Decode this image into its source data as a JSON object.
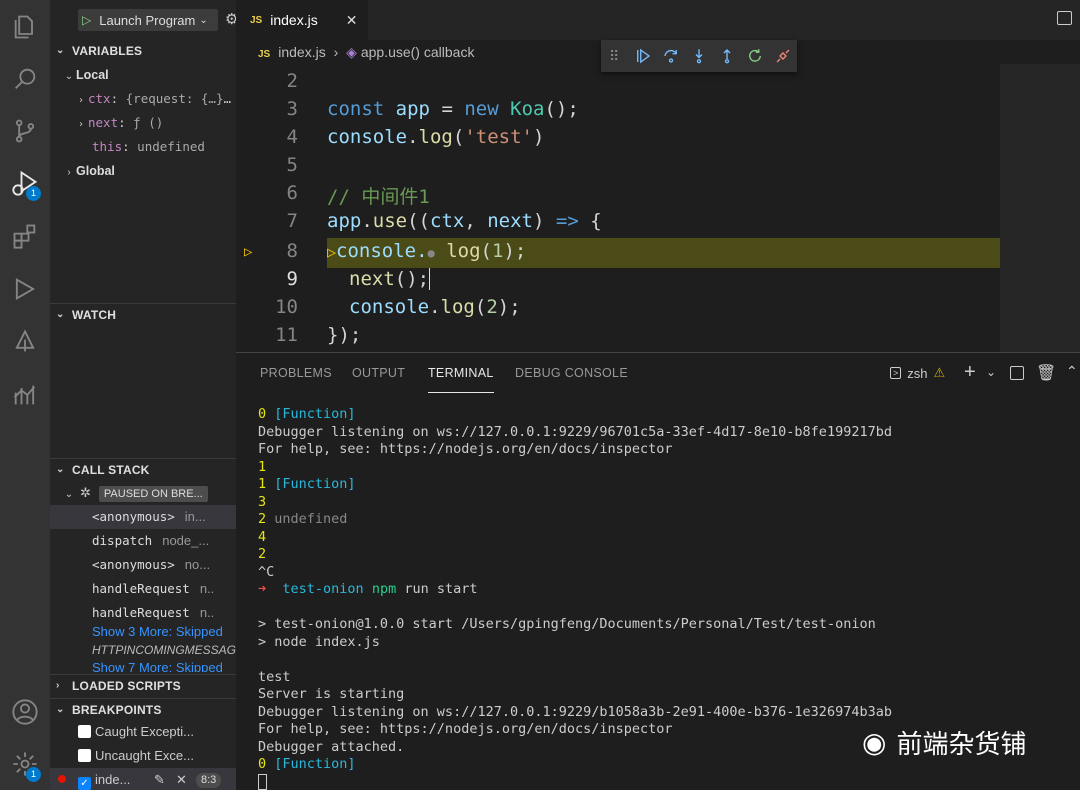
{
  "debug_toolbar": {
    "config": "Launch Program"
  },
  "sidebar": {
    "variables_title": "VARIABLES",
    "local_title": "Local",
    "variables": [
      {
        "name": "ctx",
        "value": "{request: {…}, …"
      },
      {
        "name": "next",
        "value": "ƒ ()"
      },
      {
        "name": "this",
        "value": "undefined"
      }
    ],
    "global_title": "Global",
    "watch_title": "WATCH",
    "callstack_title": "CALL STACK",
    "paused_badge": "PAUSED ON BRE...",
    "frames": [
      {
        "fn": "<anonymous>",
        "src": "in..."
      },
      {
        "fn": "dispatch",
        "src": "node_..."
      },
      {
        "fn": "<anonymous>",
        "src": "no..."
      },
      {
        "fn": "handleRequest",
        "src": "n.."
      },
      {
        "fn": "handleRequest",
        "src": "n.."
      }
    ],
    "show_more_1": "Show 3 More: Skipped",
    "httpincoming": "HTTPINCOMINGMESSAGE",
    "show_more_2": "Show 7 More: Skipped",
    "loaded_scripts_title": "LOADED SCRIPTS",
    "breakpoints_title": "BREAKPOINTS",
    "breakpoints": [
      {
        "label": "Caught Excepti..."
      },
      {
        "label": "Uncaught Exce..."
      },
      {
        "label": "inde...",
        "position": "8:3"
      }
    ]
  },
  "editor": {
    "tab": "index.js",
    "breadcrumb_file": "index.js",
    "breadcrumb_symbol": "app.use() callback",
    "line_numbers": [
      "2",
      "3",
      "4",
      "5",
      "6",
      "7",
      "8",
      "9",
      "10",
      "11"
    ],
    "lines": {
      "l3": {
        "a": "const",
        "b": "app",
        "c": "=",
        "d": "new",
        "e": "Koa",
        "f": "();"
      },
      "l4": {
        "a": "console",
        "b": ".",
        "c": "log",
        "d": "(",
        "e": "'test'",
        "f": ")"
      },
      "l6": "// 中间件1",
      "l7": {
        "a": "app",
        "b": ".",
        "c": "use",
        "d": "((",
        "e": "ctx",
        "f": ", ",
        "g": "next",
        "h": ") ",
        "i": "=>",
        "j": " {"
      },
      "l8": {
        "a": "console.",
        "b": " log",
        "c": "(",
        "d": "1",
        "e": ");"
      },
      "l9": {
        "a": "next",
        "b": "();"
      },
      "l10": {
        "a": "console",
        "b": ".",
        "c": "log",
        "d": "(",
        "e": "2",
        "f": ");"
      },
      "l11": "});"
    }
  },
  "panel": {
    "tabs": [
      "PROBLEMS",
      "OUTPUT",
      "TERMINAL",
      "DEBUG CONSOLE"
    ],
    "shell": "zsh"
  },
  "terminal": [
    {
      "a": "0 ",
      "b": "[Function]"
    },
    {
      "a": "Debugger listening on ws://127.0.0.1:9229/96701c5a-33ef-4d17-8e10-b8fe199217bd"
    },
    {
      "a": "For help, see: https://nodejs.org/en/docs/inspector"
    },
    {
      "a": "1"
    },
    {
      "a": "1 ",
      "b": "[Function]"
    },
    {
      "a": "3"
    },
    {
      "a": "2 ",
      "b": "undefined"
    },
    {
      "a": "4"
    },
    {
      "a": "2"
    },
    {
      "a": "^C"
    },
    {
      "a": "➜",
      "b": "test-onion",
      "c": "npm",
      "d": " run start"
    },
    {
      "a": "> test-onion@1.0.0 start /Users/gpingfeng/Documents/Personal/Test/test-onion"
    },
    {
      "a": "> node index.js"
    },
    {
      "a": "test"
    },
    {
      "a": "Server is starting"
    },
    {
      "a": "Debugger listening on ws://127.0.0.1:9229/b1058a3b-2e91-400e-b376-1e326974b3ab"
    },
    {
      "a": "For help, see: https://nodejs.org/en/docs/inspector"
    },
    {
      "a": "Debugger attached."
    },
    {
      "a": "0 ",
      "b": "[Function]"
    }
  ],
  "watermark": "前端杂货铺"
}
